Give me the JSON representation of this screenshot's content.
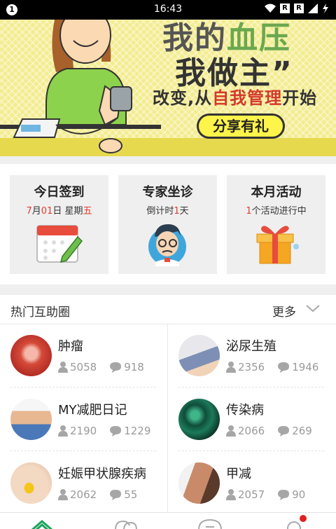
{
  "status_bar": {
    "time": "16:43",
    "left_badge": "1",
    "sim1": "R",
    "sim2": "R"
  },
  "banner": {
    "line1_a": "我的",
    "line1_b": "血压",
    "line2": "我做主”",
    "line3_a": "改变,从",
    "line3_b": "自我管理",
    "line3_c": "开始",
    "share_label": "分享有礼",
    "dots_total": 5,
    "active_dot": 5,
    "colors": {
      "bg": "#f3ec90",
      "accent_green": "#1aa45a",
      "accent_red": "#d4382c"
    }
  },
  "features": [
    {
      "title": "今日签到",
      "sub_parts": [
        "7",
        "月",
        "01",
        "日 星期",
        "五"
      ],
      "icon": "calendar-icon"
    },
    {
      "title": "专家坐诊",
      "sub_parts": [
        "倒计时",
        "1",
        "天"
      ],
      "icon": "doctor-icon"
    },
    {
      "title": "本月活动",
      "sub_parts": [
        "1",
        "个活动进行中"
      ],
      "icon": "gift-icon"
    }
  ],
  "hot_section": {
    "title": "热门互助圈",
    "more_label": "更多",
    "items": [
      {
        "name": "肿瘤",
        "members": "5058",
        "posts": "918"
      },
      {
        "name": "泌尿生殖",
        "members": "2356",
        "posts": "1946"
      },
      {
        "name": "MY减肥日记",
        "members": "2190",
        "posts": "1229"
      },
      {
        "name": "传染病",
        "members": "2066",
        "posts": "269"
      },
      {
        "name": "妊娠甲状腺疾病",
        "members": "2062",
        "posts": "55"
      },
      {
        "name": "甲减",
        "members": "2057",
        "posts": "90"
      }
    ]
  }
}
